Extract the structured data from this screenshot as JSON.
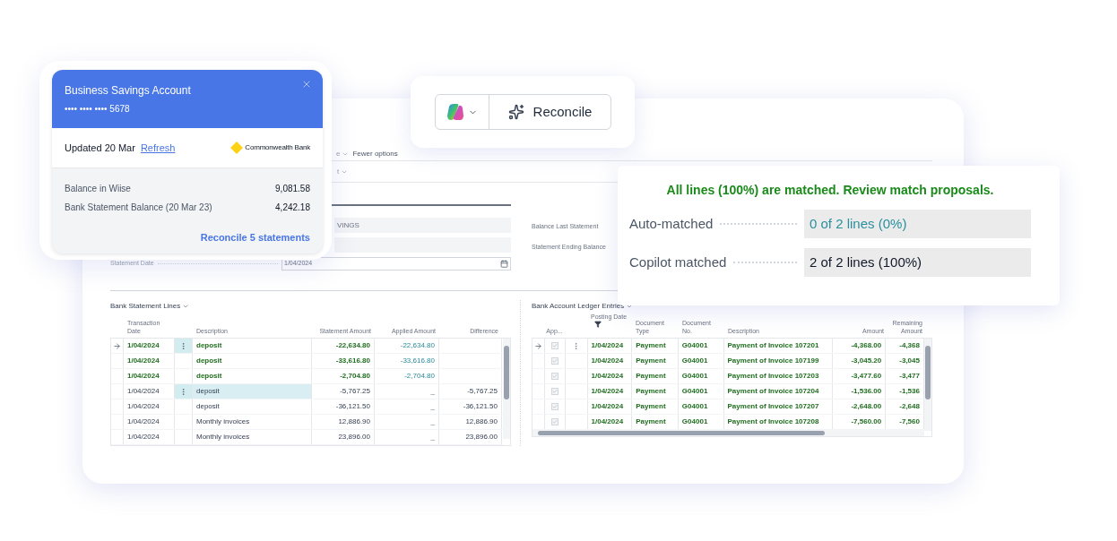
{
  "account_card": {
    "title": "Business Savings Account",
    "number": "•••• •••• •••• 5678",
    "updated": "Updated 20 Mar",
    "refresh": "Refresh",
    "bank": "Commonwealth Bank",
    "balances": [
      {
        "label": "Balance in Wiise",
        "value": "9,081.58"
      },
      {
        "label": "Bank Statement Balance (20 Mar 23)",
        "value": "4,242.18"
      }
    ],
    "action": "Reconcile 5 statements"
  },
  "toolbar": {
    "action": "Reconcile"
  },
  "match_summary": {
    "heading": "All lines (100%) are matched. Review match proposals.",
    "rows": [
      {
        "kind": "auto",
        "label": "Auto-matched",
        "value": "0 of 2 lines (0%)"
      },
      {
        "kind": "copilot",
        "label": "Copilot matched",
        "value": "2 of 2 lines (100%)"
      }
    ]
  },
  "page": {
    "filter_fragments": [
      "e",
      "t"
    ],
    "fewer_options": "Fewer options",
    "account_field_fragment": "VINGS",
    "statement_date_label": "Statement Date",
    "statement_date": "1/04/2024",
    "right_labels": [
      "Balance Last Statement",
      "Statement Ending Balance"
    ]
  },
  "statement_lines": {
    "title": "Bank Statement Lines",
    "columns": [
      "Transaction Date",
      "Description",
      "Statement Amount",
      "Applied Amount",
      "Difference"
    ],
    "rows": [
      {
        "date": "1/04/2024",
        "description": "deposit",
        "statement_amount": "-22,634.80",
        "applied_amount": "-22,634.80",
        "matched": true,
        "current": true,
        "selected": false
      },
      {
        "date": "1/04/2024",
        "description": "deposit",
        "statement_amount": "-33,616.80",
        "applied_amount": "-33,616.80",
        "matched": true,
        "current": false,
        "selected": false
      },
      {
        "date": "1/04/2024",
        "description": "deposit",
        "statement_amount": "-2,704.80",
        "applied_amount": "-2,704.80",
        "matched": true,
        "current": false,
        "selected": false
      },
      {
        "date": "1/04/2024",
        "description": "deposit",
        "statement_amount": "-5,767.25",
        "applied_amount": "_",
        "difference": "-5,767.25",
        "matched": false,
        "current": false,
        "selected": true
      },
      {
        "date": "1/04/2024",
        "description": "deposit",
        "statement_amount": "-36,121.50",
        "applied_amount": "_",
        "difference": "-36,121.50",
        "matched": false,
        "current": false,
        "selected": false
      },
      {
        "date": "1/04/2024",
        "description": "Monthly invoices",
        "statement_amount": "12,886.90",
        "applied_amount": "_",
        "difference": "12,886.90",
        "matched": false,
        "current": false,
        "selected": false
      },
      {
        "date": "1/04/2024",
        "description": "Monthly invoices",
        "statement_amount": "23,896.00",
        "applied_amount": "_",
        "difference": "23,896.00",
        "matched": false,
        "current": false,
        "selected": false
      }
    ]
  },
  "ledger_entries": {
    "title": "Bank Account Ledger Entries",
    "columns": [
      "App...",
      "Posting Date",
      "Document Type",
      "Document No.",
      "Description",
      "Amount",
      "Remaining Amount"
    ],
    "rows": [
      {
        "applied": true,
        "current": true,
        "date": "1/04/2024",
        "doc_type": "Payment",
        "doc_no": "G04001",
        "description": "Payment of Invoice 107201",
        "amount": "-4,368.00",
        "remaining": "-4,368"
      },
      {
        "applied": true,
        "current": false,
        "date": "1/04/2024",
        "doc_type": "Payment",
        "doc_no": "G04001",
        "description": "Payment of Invoice 107199",
        "amount": "-3,045.20",
        "remaining": "-3,045"
      },
      {
        "applied": true,
        "current": false,
        "date": "1/04/2024",
        "doc_type": "Payment",
        "doc_no": "G04001",
        "description": "Payment of Invoice 107203",
        "amount": "-3,477.60",
        "remaining": "-3,477"
      },
      {
        "applied": true,
        "current": false,
        "date": "1/04/2024",
        "doc_type": "Payment",
        "doc_no": "G04001",
        "description": "Payment of Invoice 107204",
        "amount": "-1,536.00",
        "remaining": "-1,536"
      },
      {
        "applied": true,
        "current": false,
        "date": "1/04/2024",
        "doc_type": "Payment",
        "doc_no": "G04001",
        "description": "Payment of Invoice 107207",
        "amount": "-2,648.00",
        "remaining": "-2,648"
      },
      {
        "applied": true,
        "current": false,
        "date": "1/04/2024",
        "doc_type": "Payment",
        "doc_no": "G04001",
        "description": "Payment of Invoice 107208",
        "amount": "-7,560.00",
        "remaining": "-7,560"
      }
    ]
  }
}
